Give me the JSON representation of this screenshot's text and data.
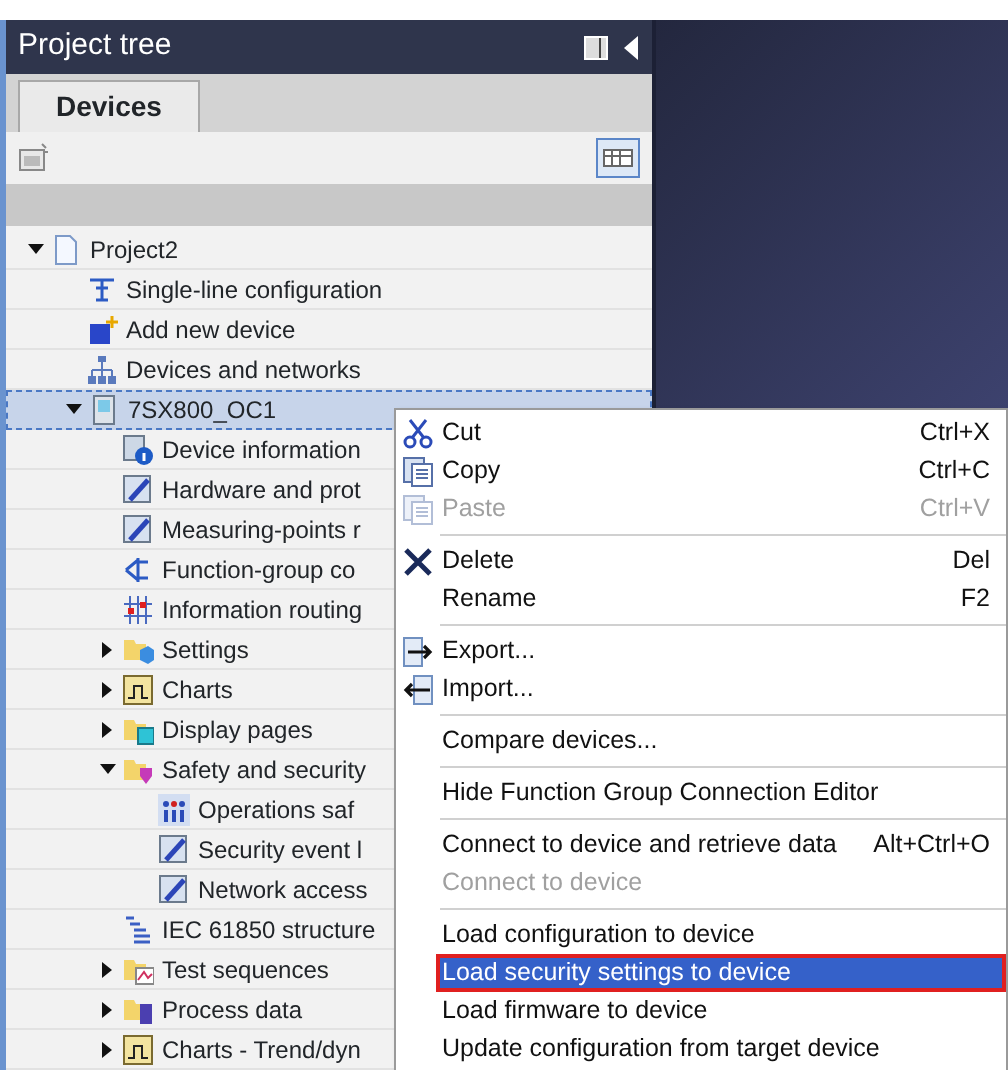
{
  "panel": {
    "title": "Project tree"
  },
  "tabs": [
    {
      "label": "Devices",
      "selected": true
    }
  ],
  "tree": [
    {
      "label": "Project2",
      "kind": "document",
      "expanded": true,
      "selected": false,
      "children": [
        {
          "label": "Single-line configuration",
          "kind": "single-line",
          "selected": false
        },
        {
          "label": "Add new device",
          "kind": "add-device",
          "selected": false
        },
        {
          "label": "Devices and networks",
          "kind": "network",
          "selected": false
        },
        {
          "label": "7SX800_OC1",
          "kind": "device",
          "expanded": true,
          "selected": true,
          "children": [
            {
              "label": "Device information",
              "kind": "info",
              "selected": false
            },
            {
              "label": "Hardware and prot",
              "kind": "edit",
              "selected": false
            },
            {
              "label": "Measuring-points r",
              "kind": "edit",
              "selected": false
            },
            {
              "label": "Function-group co",
              "kind": "connector",
              "selected": false
            },
            {
              "label": "Information routing",
              "kind": "grid",
              "selected": false
            },
            {
              "label": "Settings",
              "kind": "folder-cube",
              "expanded": false,
              "selected": false
            },
            {
              "label": "Charts",
              "kind": "chart",
              "expanded": false,
              "selected": false
            },
            {
              "label": "Display pages",
              "kind": "folder-screen",
              "expanded": false,
              "selected": false
            },
            {
              "label": "Safety and security",
              "kind": "folder-shield",
              "expanded": true,
              "selected": false,
              "children": [
                {
                  "label": "Operations saf",
                  "kind": "people",
                  "selected": false
                },
                {
                  "label": "Security event l",
                  "kind": "edit",
                  "selected": false
                },
                {
                  "label": "Network access",
                  "kind": "edit",
                  "selected": false
                }
              ]
            },
            {
              "label": "IEC 61850 structure",
              "kind": "structure",
              "selected": false
            },
            {
              "label": "Test sequences",
              "kind": "folder-chart",
              "expanded": false,
              "selected": false
            },
            {
              "label": "Process data",
              "kind": "folder-device",
              "expanded": false,
              "selected": false
            },
            {
              "label": "Charts - Trend/dyn",
              "kind": "chart",
              "expanded": false,
              "selected": false
            }
          ]
        }
      ]
    }
  ],
  "context_menu": [
    [
      {
        "label": "Cut",
        "shortcut": "Ctrl+X",
        "kind": "scissors",
        "disabled": false,
        "selected": false
      },
      {
        "label": "Copy",
        "shortcut": "Ctrl+C",
        "kind": "copy",
        "disabled": false,
        "selected": false
      },
      {
        "label": "Paste",
        "shortcut": "Ctrl+V",
        "kind": "copy",
        "disabled": true,
        "selected": false
      }
    ],
    [
      {
        "label": "Delete",
        "shortcut": "Del",
        "kind": "cross",
        "disabled": false,
        "selected": false
      },
      {
        "label": "Rename",
        "shortcut": "F2",
        "disabled": false,
        "selected": false
      }
    ],
    [
      {
        "label": "Export...",
        "kind": "arrow-right",
        "disabled": false,
        "selected": false
      },
      {
        "label": "Import...",
        "kind": "arrow-left",
        "disabled": false,
        "selected": false
      }
    ],
    [
      {
        "label": "Compare devices...",
        "disabled": false,
        "selected": false
      }
    ],
    [
      {
        "label": "Hide Function Group Connection Editor",
        "disabled": false,
        "selected": false
      }
    ],
    [
      {
        "label": "Connect to device and retrieve data",
        "shortcut": "Alt+Ctrl+O",
        "disabled": false,
        "selected": false
      },
      {
        "label": "Connect to device",
        "disabled": true,
        "selected": false
      }
    ],
    [
      {
        "label": "Load configuration to device",
        "disabled": false,
        "selected": false
      },
      {
        "label": "Load security settings to device",
        "disabled": false,
        "selected": true
      },
      {
        "label": "Load firmware to device",
        "disabled": false,
        "selected": false
      },
      {
        "label": "Update configuration from target device",
        "disabled": false,
        "selected": false
      }
    ]
  ]
}
